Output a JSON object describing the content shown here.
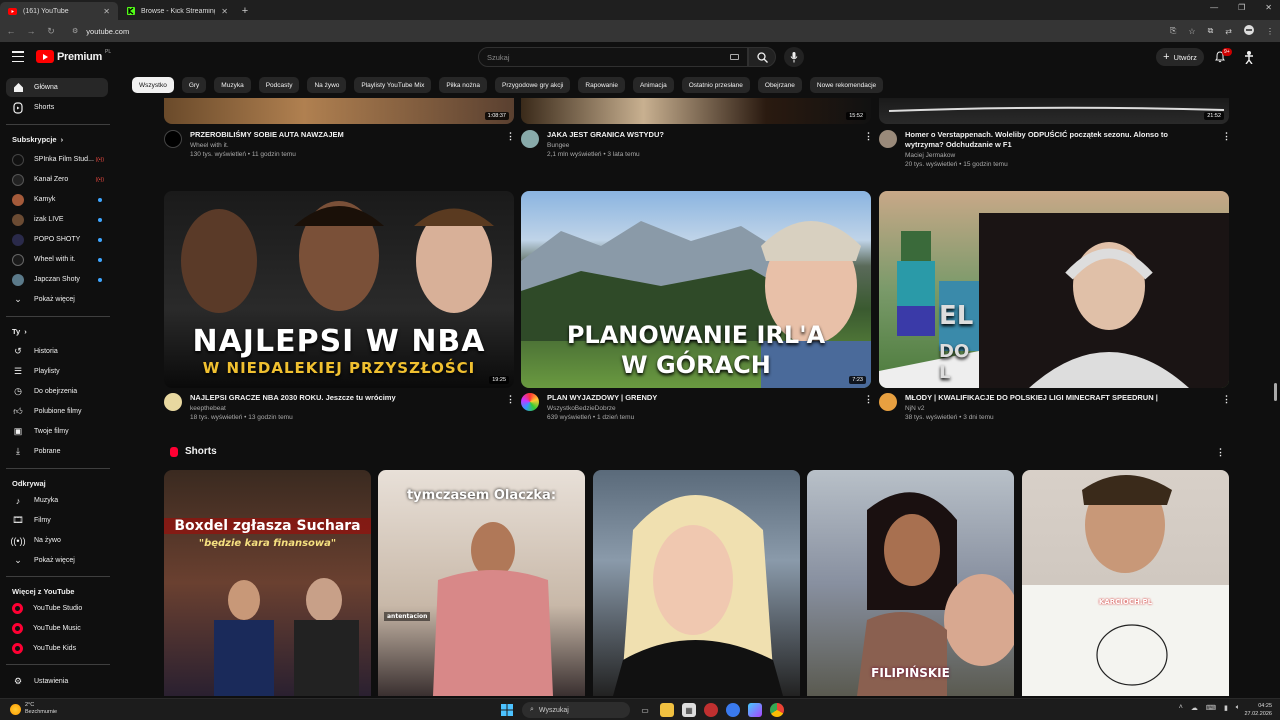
{
  "browser": {
    "tabs": [
      {
        "label": "(161) YouTube",
        "icon": "youtube-icon",
        "active": true
      },
      {
        "label": "Browse - Kick Streaming",
        "icon": "kick-icon",
        "active": false
      }
    ],
    "url": "youtube.com"
  },
  "header": {
    "logo_text": "Premium",
    "logo_region": "PL",
    "search_placeholder": "Szukaj",
    "create_label": "Utwórz",
    "notifications_badge": "9+"
  },
  "sidebar": {
    "main": [
      {
        "label": "Główna",
        "icon": "home-icon",
        "active": true
      },
      {
        "label": "Shorts",
        "icon": "shorts-icon",
        "active": false
      }
    ],
    "subscriptions_title": "Subskrypcje",
    "subscriptions": [
      {
        "label": "SPInka Film Stud...",
        "status": "live"
      },
      {
        "label": "Kanał Zero",
        "status": "live"
      },
      {
        "label": "Kamyk",
        "status": "dot"
      },
      {
        "label": "izak LIVE",
        "status": "dot"
      },
      {
        "label": "POPO SHOTY",
        "status": "dot"
      },
      {
        "label": "Wheel with it.",
        "status": "dot"
      },
      {
        "label": "Japczan Shoty",
        "status": "dot"
      }
    ],
    "show_more": "Pokaż więcej",
    "you_title": "Ty",
    "you": [
      {
        "label": "Historia",
        "icon": "history-icon"
      },
      {
        "label": "Playlisty",
        "icon": "playlist-icon"
      },
      {
        "label": "Do obejrzenia",
        "icon": "clock-icon"
      },
      {
        "label": "Polubione filmy",
        "icon": "thumbs-up-icon"
      },
      {
        "label": "Twoje filmy",
        "icon": "video-icon"
      },
      {
        "label": "Pobrane",
        "icon": "download-icon"
      }
    ],
    "explore_title": "Odkrywaj",
    "explore": [
      {
        "label": "Muzyka",
        "icon": "music-icon"
      },
      {
        "label": "Filmy",
        "icon": "film-icon"
      },
      {
        "label": "Na żywo",
        "icon": "live-icon"
      },
      {
        "label": "Pokaż więcej",
        "icon": "chevron-down-icon"
      }
    ],
    "more_title": "Więcej z YouTube",
    "more": [
      {
        "label": "YouTube Studio"
      },
      {
        "label": "YouTube Music"
      },
      {
        "label": "YouTube Kids"
      }
    ],
    "settings": "Ustawienia"
  },
  "chips": [
    "Wszystko",
    "Gry",
    "Muzyka",
    "Podcasty",
    "Na żywo",
    "Playlisty YouTube Mix",
    "Piłka nożna",
    "Przygodowe gry akcji",
    "Rapowanie",
    "Animacja",
    "Ostatnio przesłane",
    "Obejrzane",
    "Nowe rekomendacje"
  ],
  "videos_top": [
    {
      "title": "PRZEROBILIŚMY SOBIE AUTA NAWZAJEM",
      "channel": "Wheel with it.",
      "stats": "130 tys. wyświetleń • 11 godzin temu",
      "duration": "1:08:37"
    },
    {
      "title": "JAKA JEST GRANICA WSTYDU?",
      "channel": "Bungee",
      "stats": "2,1 mln wyświetleń • 3 lata temu",
      "duration": "15:52"
    },
    {
      "title": "Homer o Verstappenach. Woleliby ODPUŚCIĆ początek sezonu. Alonso to wytrzyma? Odchudzanie w F1",
      "channel": "Maciej Jermakow",
      "stats": "20 tys. wyświetleń • 15 godzin temu",
      "duration": "21:52"
    }
  ],
  "videos": [
    {
      "title": "NAJLEPSI GRACZE NBA 2030 ROKU. Jeszcze tu wrócimy",
      "channel": "keepthebeat",
      "stats": "18 tys. wyświetleń • 13 godzin temu",
      "duration": "19:25",
      "overlay1": "NAJLEPSI W NBA",
      "overlay2": "W NIEDALEKIEJ PRZYSZŁOŚCI"
    },
    {
      "title": "PLAN WYJAZDOWY | GRENDY",
      "channel": "WszystkoBedzieDobrze",
      "stats": "639 wyświetleń • 1 dzień temu",
      "duration": "7:23",
      "overlay1": "PLANOWANIE IRL'A",
      "overlay2": "W GÓRACH"
    },
    {
      "title": "MŁODY | KWALIFIKACJE DO POLSKIEJ LIGI MINECRAFT SPEEDRUN |",
      "channel": "NjN v2",
      "stats": "38 tys. wyświetleń • 3 dni temu",
      "duration": "",
      "overlay1": "EL",
      "overlay2": "DO L"
    }
  ],
  "shorts": {
    "title": "Shorts",
    "items": [
      {
        "caption1": "Boxdel zgłasza Suchara",
        "caption2": "\"będzie kara finansowa\""
      },
      {
        "caption1": "tymczasem Olaczka:",
        "caption2": "antentacion"
      },
      {
        "caption1": "",
        "caption2": ""
      },
      {
        "caption1": "FILIPIŃSKIE",
        "caption2": ""
      },
      {
        "caption1": "KARCIOCH.PL",
        "caption2": ""
      }
    ]
  },
  "taskbar": {
    "temperature": "2°C",
    "weather": "Bezchmurnie",
    "search_label": "Wyszukaj",
    "time": "04:25",
    "date": "27.02.2026"
  },
  "colors": {
    "accent": "#ff0033",
    "background": "#0f0f0f",
    "chip": "#272727"
  }
}
